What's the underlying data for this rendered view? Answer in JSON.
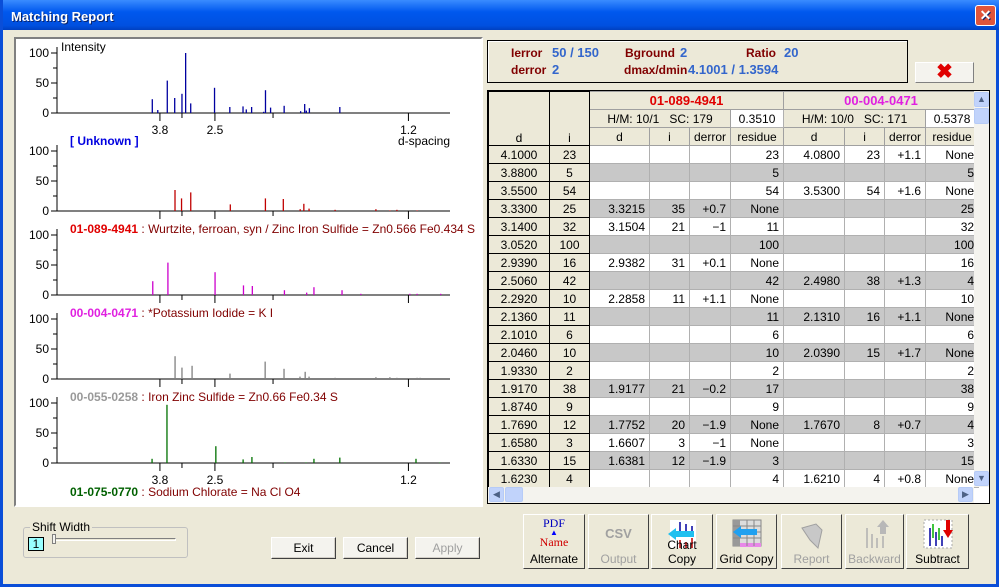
{
  "window": {
    "title": "Matching Report",
    "close_icon": "close-icon"
  },
  "info": {
    "ierror_label": "Ierror",
    "ierror_value": "50 / 150",
    "derror_label": "derror",
    "derror_value": "2",
    "bground_label": "Bground",
    "bground_value": "2",
    "dmaxmin_label": "dmax/dmin",
    "dmaxmin_value": "4.1001 / 1.3594",
    "ratio_label": "Ratio",
    "ratio_value": "20",
    "delete_icon": "red-x-icon"
  },
  "grid": {
    "col_d": "d",
    "col_i": "i",
    "matches": [
      {
        "id": "01-089-4941",
        "color": "#E00000",
        "hm": "H/M: 10/1",
        "sc": "SC: 179",
        "score": "0.3510",
        "cols": [
          "d",
          "i",
          "derror",
          "residue"
        ]
      },
      {
        "id": "00-004-0471",
        "color": "#E020E0",
        "hm": "H/M: 10/0",
        "sc": "SC: 171",
        "score": "0.5378",
        "cols": [
          "d",
          "i",
          "derror",
          "residue"
        ]
      }
    ],
    "rows": [
      [
        "4.1000",
        "23",
        "",
        "",
        "",
        "23",
        "4.0800",
        "23",
        "+1.1",
        "None"
      ],
      [
        "3.8800",
        "5",
        "",
        "",
        "",
        "5",
        "",
        "",
        "",
        "5"
      ],
      [
        "3.5500",
        "54",
        "",
        "",
        "",
        "54",
        "3.5300",
        "54",
        "+1.6",
        "None"
      ],
      [
        "3.3300",
        "25",
        "3.3215",
        "35",
        "+0.7",
        "None",
        "",
        "",
        "",
        "25"
      ],
      [
        "3.1400",
        "32",
        "3.1504",
        "21",
        "−1",
        "11",
        "",
        "",
        "",
        "32"
      ],
      [
        "3.0520",
        "100",
        "",
        "",
        "",
        "100",
        "",
        "",
        "",
        "100"
      ],
      [
        "2.9390",
        "16",
        "2.9382",
        "31",
        "+0.1",
        "None",
        "",
        "",
        "",
        "16"
      ],
      [
        "2.5060",
        "42",
        "",
        "",
        "",
        "42",
        "2.4980",
        "38",
        "+1.3",
        "4"
      ],
      [
        "2.2920",
        "10",
        "2.2858",
        "11",
        "+1.1",
        "None",
        "",
        "",
        "",
        "10"
      ],
      [
        "2.1360",
        "11",
        "",
        "",
        "",
        "11",
        "2.1310",
        "16",
        "+1.1",
        "None"
      ],
      [
        "2.1010",
        "6",
        "",
        "",
        "",
        "6",
        "",
        "",
        "",
        "6"
      ],
      [
        "2.0460",
        "10",
        "",
        "",
        "",
        "10",
        "2.0390",
        "15",
        "+1.7",
        "None"
      ],
      [
        "1.9330",
        "2",
        "",
        "",
        "",
        "2",
        "",
        "",
        "",
        "2"
      ],
      [
        "1.9170",
        "38",
        "1.9177",
        "21",
        "−0.2",
        "17",
        "",
        "",
        "",
        "38"
      ],
      [
        "1.8740",
        "9",
        "",
        "",
        "",
        "9",
        "",
        "",
        "",
        "9"
      ],
      [
        "1.7690",
        "12",
        "1.7752",
        "20",
        "−1.9",
        "None",
        "1.7670",
        "8",
        "+0.7",
        "4"
      ],
      [
        "1.6580",
        "3",
        "1.6607",
        "3",
        "−1",
        "None",
        "",
        "",
        "",
        "3"
      ],
      [
        "1.6330",
        "15",
        "1.6381",
        "12",
        "−1.9",
        "3",
        "",
        "",
        "",
        "15"
      ],
      [
        "1.6230",
        "4",
        "",
        "",
        "",
        "4",
        "1.6210",
        "4",
        "+0.8",
        "None"
      ]
    ]
  },
  "shift_width": {
    "label": "Shift Width",
    "value": "1",
    "slider_level": 1,
    "slider_max": 5
  },
  "buttons": {
    "exit": "Exit",
    "cancel": "Cancel",
    "apply": "Apply"
  },
  "toolbar": [
    {
      "label": "Alternate",
      "icon": "pdf-name-toggle-icon",
      "icon_top": "PDF",
      "icon_bottom": "Name",
      "enabled": true
    },
    {
      "label": "Output",
      "icon": "csv-icon",
      "icon_text": "CSV",
      "enabled": false
    },
    {
      "label": "Chart Copy",
      "icon": "chart-copy-icon",
      "enabled": true
    },
    {
      "label": "Grid Copy",
      "icon": "grid-copy-icon",
      "enabled": true
    },
    {
      "label": "Report",
      "icon": "report-hand-icon",
      "enabled": false
    },
    {
      "label": "Backward",
      "icon": "backward-icon",
      "enabled": false
    },
    {
      "label": "Subtract",
      "icon": "subtract-icon",
      "enabled": true
    }
  ],
  "chart_data": {
    "type": "bar",
    "xlabel": "d-spacing",
    "ylabel": "Intensity",
    "x_ticks": [
      "3.8",
      "2.5",
      "1.2"
    ],
    "y_ticks": [
      "100",
      "50",
      "0"
    ],
    "ylim": [
      0,
      100
    ],
    "grid": false,
    "panels": [
      {
        "id": "[ Unknown ]",
        "description": "",
        "color": "#0000A0",
        "caption_color": "#0000E0",
        "peaks": [
          [
            4.1,
            23
          ],
          [
            3.88,
            5
          ],
          [
            3.55,
            54
          ],
          [
            3.33,
            25
          ],
          [
            3.14,
            32
          ],
          [
            3.052,
            100
          ],
          [
            2.939,
            16
          ],
          [
            2.506,
            42
          ],
          [
            2.292,
            10
          ],
          [
            2.136,
            11
          ],
          [
            2.101,
            6
          ],
          [
            2.046,
            10
          ],
          [
            1.933,
            2
          ],
          [
            1.917,
            38
          ],
          [
            1.874,
            9
          ],
          [
            1.769,
            12
          ],
          [
            1.658,
            3
          ],
          [
            1.633,
            15
          ],
          [
            1.623,
            4
          ],
          [
            1.605,
            8
          ],
          [
            1.448,
            10
          ]
        ]
      },
      {
        "id": "01-089-4941",
        "description": " : Wurtzite, ferroan, syn / Zinc Iron Sulfide = Zn0.566 Fe0.434 S",
        "color": "#C00000",
        "caption_color": "#E00000",
        "peaks": [
          [
            3.3215,
            35
          ],
          [
            3.1504,
            21
          ],
          [
            2.9382,
            31
          ],
          [
            2.2858,
            11
          ],
          [
            1.9177,
            21
          ],
          [
            1.7752,
            20
          ],
          [
            1.6607,
            3
          ],
          [
            1.6381,
            12
          ],
          [
            1.607,
            4
          ],
          [
            1.47,
            2
          ],
          [
            1.303,
            3
          ],
          [
            1.256,
            1
          ],
          [
            1.234,
            2
          ],
          [
            1.176,
            1
          ]
        ]
      },
      {
        "id": "00-004-0471",
        "description": " : *Potassium Iodide = K I",
        "color": "#CC00CC",
        "caption_color": "#E020E0",
        "peaks": [
          [
            4.08,
            23
          ],
          [
            3.53,
            54
          ],
          [
            2.498,
            38
          ],
          [
            2.131,
            16
          ],
          [
            2.039,
            15
          ],
          [
            1.767,
            8
          ],
          [
            1.621,
            4
          ],
          [
            1.579,
            13
          ],
          [
            1.438,
            8
          ],
          [
            1.359,
            2
          ],
          [
            1.196,
            2
          ],
          [
            1.176,
            2
          ],
          [
            1.117,
            2
          ]
        ]
      },
      {
        "id": "00-055-0258",
        "description": " : Iron Zinc Sulfide = Zn0.66 Fe0.34 S",
        "color": "#808080",
        "caption_color": "#999999",
        "peaks": [
          [
            3.32,
            38
          ],
          [
            3.14,
            19
          ],
          [
            2.91,
            22
          ],
          [
            2.29,
            9
          ],
          [
            1.92,
            29
          ],
          [
            1.77,
            17
          ],
          [
            1.662,
            4
          ],
          [
            1.63,
            12
          ],
          [
            1.607,
            4
          ],
          [
            1.47,
            2
          ],
          [
            1.303,
            3
          ],
          [
            1.256,
            3
          ],
          [
            1.234,
            2
          ],
          [
            1.176,
            2
          ],
          [
            1.168,
            2
          ]
        ]
      },
      {
        "id": "01-075-0770",
        "description": " : Sodium Chlorate = Na Cl O4",
        "color": "#007000",
        "caption_color": "#006000",
        "peaks": [
          [
            4.11,
            7
          ],
          [
            3.56,
            97
          ],
          [
            2.486,
            28
          ],
          [
            2.135,
            6
          ],
          [
            2.043,
            10
          ],
          [
            1.763,
            1
          ],
          [
            1.625,
            1
          ],
          [
            1.579,
            7
          ],
          [
            1.448,
            9
          ],
          [
            1.179,
            7
          ],
          [
            1.119,
            1
          ]
        ]
      }
    ]
  }
}
